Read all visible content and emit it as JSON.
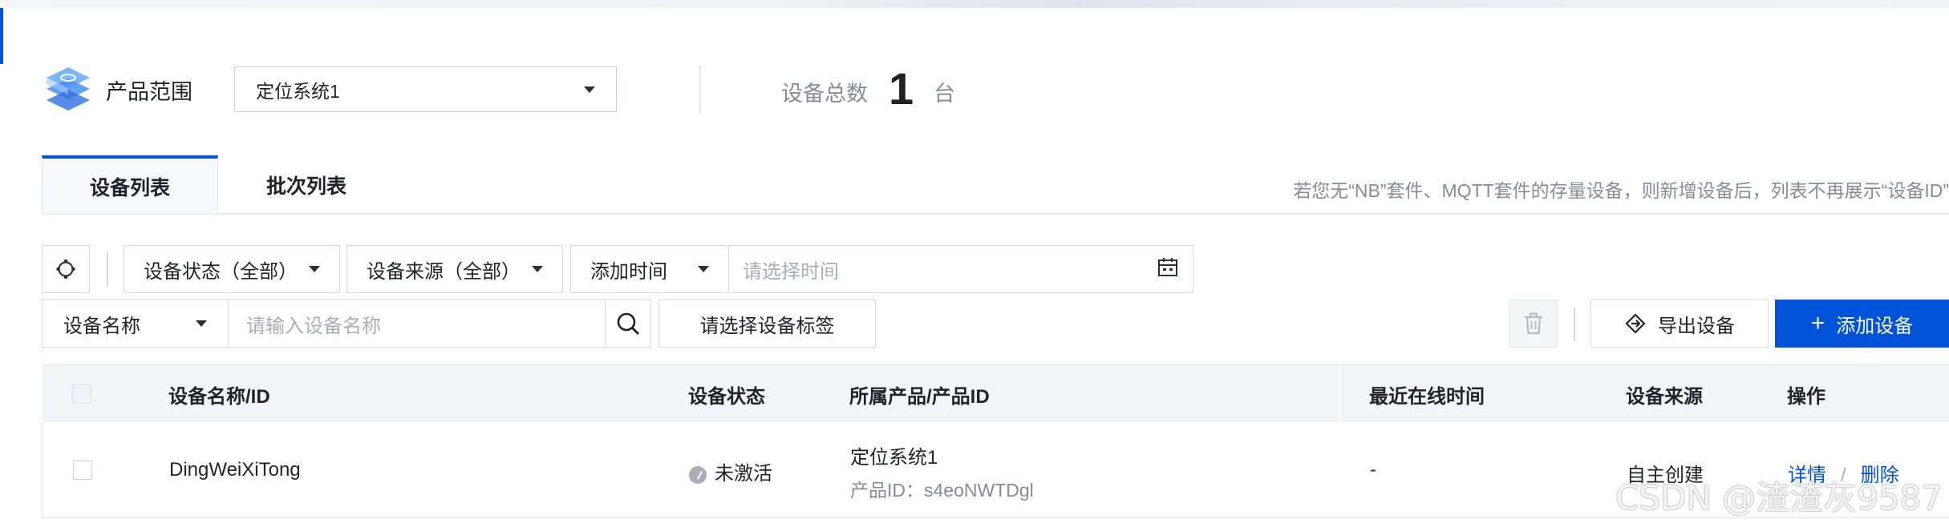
{
  "product": {
    "label": "产品范围",
    "selected": "定位系统1",
    "total_label": "设备总数",
    "total_count": "1",
    "total_unit": "台"
  },
  "tabs": [
    {
      "label": "设备列表",
      "active": true
    },
    {
      "label": "批次列表",
      "active": false
    }
  ],
  "tip": "若您无“NB”套件、MQTT套件的存量设备，则新增设备后，列表不再展示“设备ID”",
  "filters": {
    "status": "设备状态（全部）",
    "source": "设备来源（全部）",
    "time_type": "添加时间",
    "time_placeholder": "请选择时间",
    "name_type": "设备名称",
    "name_placeholder": "请输入设备名称",
    "tag_button": "请选择设备标签"
  },
  "actions": {
    "export": "导出设备",
    "add": "添加设备"
  },
  "table": {
    "headers": [
      "设备名称/ID",
      "设备状态",
      "所属产品/产品ID",
      "最近在线时间",
      "设备来源",
      "操作"
    ],
    "rows": [
      {
        "name": "DingWeiXiTong",
        "status": "未激活",
        "product": "定位系统1",
        "product_id": "产品ID：s4eoNWTDgl",
        "last_online": "-",
        "source": "自主创建",
        "detail": "详情",
        "separator": "/",
        "delete": "删除"
      }
    ]
  },
  "watermark": "CSDN @渣渣灰9587",
  "colors": {
    "primary": "#0052d9",
    "muted_text": "#868c96",
    "header_bg": "#f3f4f7"
  },
  "icons": [
    "product-cube-icon",
    "refresh-icon",
    "calendar-icon",
    "search-icon",
    "trash-icon",
    "export-icon",
    "plus-icon",
    "status-inactive-icon"
  ]
}
